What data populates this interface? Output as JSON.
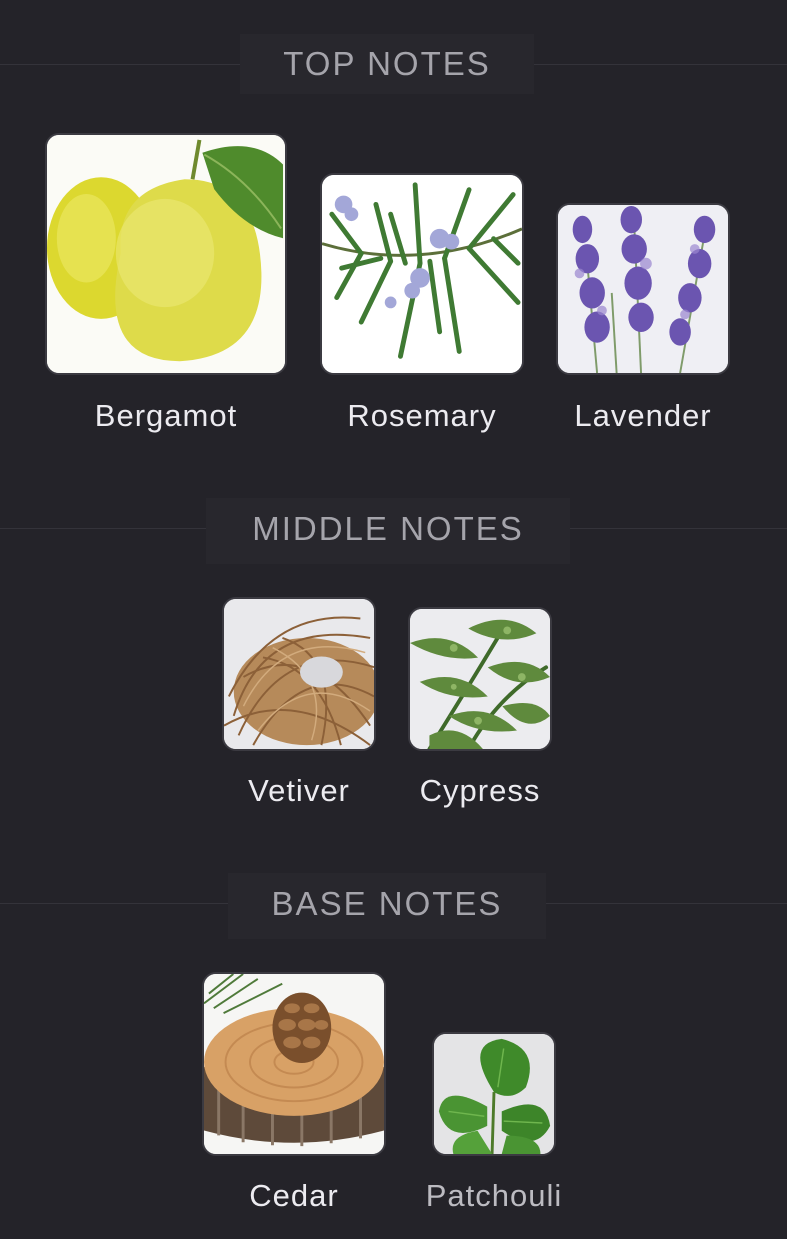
{
  "sections": {
    "top": {
      "title": "TOP NOTES",
      "notes": [
        {
          "name": "Bergamot",
          "image": "bergamot-fruit-image"
        },
        {
          "name": "Rosemary",
          "image": "rosemary-sprig-image"
        },
        {
          "name": "Lavender",
          "image": "lavender-flowers-image"
        }
      ]
    },
    "middle": {
      "title": "MIDDLE NOTES",
      "notes": [
        {
          "name": "Vetiver",
          "image": "vetiver-root-image"
        },
        {
          "name": "Cypress",
          "image": "cypress-branch-image"
        }
      ]
    },
    "base": {
      "title": "BASE NOTES",
      "notes": [
        {
          "name": "Cedar",
          "image": "cedar-log-pinecone-image"
        },
        {
          "name": "Patchouli",
          "image": "patchouli-leaves-image"
        }
      ]
    }
  },
  "colors": {
    "background": "#242329",
    "header_text": "#a5a4ab",
    "label_text": "#ecebf0"
  }
}
